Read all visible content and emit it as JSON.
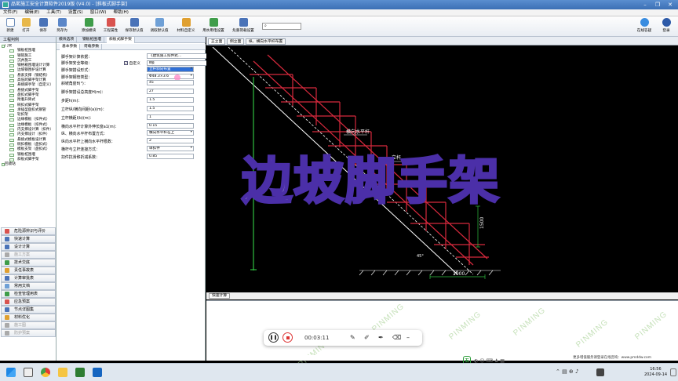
{
  "window": {
    "title": "品茗施工安全计算软件2019版 (V4.0) - [斜板式脚手架]"
  },
  "menu": [
    "文件(F)",
    "编辑(E)",
    "工具(T)",
    "设置(S)",
    "窗口(W)",
    "帮助(H)"
  ],
  "toolbar": {
    "buttons": [
      "新建",
      "打开",
      "保存",
      "另存为",
      "添加模块",
      "工程属性",
      "保存默认值",
      "调取默认值",
      "材料自定义",
      "用水用电设置",
      "危重荷载设置"
    ],
    "right_buttons": [
      "在线答疑",
      "登录"
    ]
  },
  "left_panel": {
    "title": "工程判例",
    "tree": [
      "门架",
      "钢板桩围堰",
      "钢管施工",
      "沉井施工",
      "钢格箱围堰设计计算",
      "边坡钢围护设计算",
      "悬索支撑（钢结构）",
      "高低跨脚手架计算",
      "悬挑脚手架（自定义）",
      "悬挑式脚手架",
      "盘扣式脚手架",
      "附着升降式",
      "碗扣式脚手架",
      "承插型盘扣式钢管",
      "轮扣架",
      "边缘模板（扣件式）",
      "边缘模板（扣件式）",
      "内支撑设计算（扣件）",
      "内支撑设计（扣件）",
      "悬挑式模板设计算",
      "碗扣模板（盘扣式）",
      "模板支架（盘扣式）",
      "钢板桩围堰",
      "斜板式脚手架"
    ],
    "tree_root_2": "回收站",
    "buttons": [
      {
        "label": "危险源辨识与评价",
        "disabled": false
      },
      {
        "label": "快速计算",
        "disabled": false
      },
      {
        "label": "设计计算",
        "disabled": false
      },
      {
        "label": "施工方案",
        "disabled": true
      },
      {
        "label": "技术交底",
        "disabled": false
      },
      {
        "label": "责任事故表",
        "disabled": false
      },
      {
        "label": "计算审批表",
        "disabled": false
      },
      {
        "label": "常用文档",
        "disabled": false
      },
      {
        "label": "检查管理用表",
        "disabled": false
      },
      {
        "label": "应急预案",
        "disabled": false
      },
      {
        "label": "节点详图集",
        "disabled": false
      },
      {
        "label": "材料优化",
        "disabled": false
      },
      {
        "label": "施工图",
        "disabled": true
      },
      {
        "label": "防护预案",
        "disabled": true
      }
    ]
  },
  "center_panel": {
    "tabs_top": [
      "模块选项",
      "钢板桩围堰",
      "斜板式脚手架"
    ],
    "tabs_sub": [
      "基本参数",
      "荷载参数"
    ],
    "checkbox_label": "自定义",
    "params": [
      {
        "label": "脚手架计算依据：",
        "value": "《建筑施工扣件式…",
        "type": "select"
      },
      {
        "label": "脚手架安全等级：",
        "value": "Ⅱ级",
        "type": "select"
      },
      {
        "label": "脚手架搭设形式：",
        "value": "立杆斜向布置",
        "type": "select",
        "highlight": true
      },
      {
        "label": "脚手架钢管类型：",
        "value": "Φ48.3×3.6",
        "type": "select"
      },
      {
        "label": "斜坡角度θ(°)：",
        "value": "45",
        "type": "text"
      },
      {
        "label": "脚手架搭设总高度H(m)：",
        "value": "27",
        "type": "text"
      },
      {
        "label": "步距h(m)：",
        "value": "1.5",
        "type": "text"
      },
      {
        "label": "立杆纵/横向间距l(a)(m)：",
        "value": "1.5",
        "type": "text"
      },
      {
        "label": "立杆横距l(b)(m)：",
        "value": "1",
        "type": "text"
      },
      {
        "label": "横向水平杆计算外伸长度a1(m)：",
        "value": "0.15",
        "type": "text"
      },
      {
        "label": "纵、横向水平杆布置方式：",
        "value": "横向水平杆在上",
        "type": "select"
      },
      {
        "label": "纵向水平杆上横向水平杆根数：",
        "value": "2",
        "type": "text"
      },
      {
        "label": "横杆与立杆连接方式：",
        "value": "单扣件",
        "type": "select"
      },
      {
        "label": "扣件抗滑移折减系数：",
        "value": "0.85",
        "type": "text"
      }
    ]
  },
  "right_panel": {
    "tabs": [
      "正立面",
      "侧立面",
      "纵、横向水平杆布置"
    ],
    "drawing_labels": {
      "horizontal_bar": "横向水平杆",
      "vertical_bar": "立杆",
      "dim_1500": "1500",
      "dim_1000": "1000",
      "angle": "45°"
    },
    "quick_calc_button": "快速计算"
  },
  "overlay": {
    "title": "边坡脚手架"
  },
  "watermark": "PINMING",
  "recorder": {
    "time": "00:03:11"
  },
  "status": {
    "text": "更多增值服务请登录在线咨询：www.pmddw.com"
  },
  "ime": {
    "label": "五"
  },
  "taskbar": {
    "time": "16:56",
    "date": "2024-09-14"
  }
}
